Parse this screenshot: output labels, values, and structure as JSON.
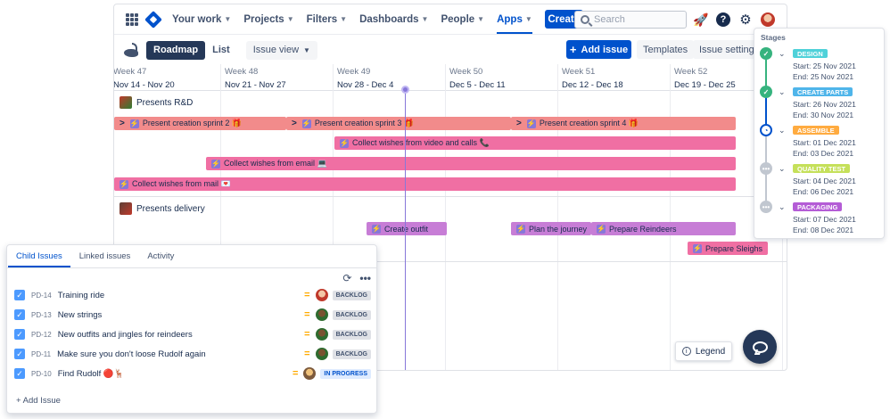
{
  "nav": {
    "items": [
      {
        "label": "Your work"
      },
      {
        "label": "Projects"
      },
      {
        "label": "Filters"
      },
      {
        "label": "Dashboards"
      },
      {
        "label": "People"
      },
      {
        "label": "Apps"
      }
    ],
    "active": "Apps",
    "create_label": "Create",
    "search_placeholder": "Search"
  },
  "toolbar": {
    "roadmap_label": "Roadmap",
    "list_label": "List",
    "view_label": "Issue view",
    "add_issue_label": "Add issue",
    "templates_label": "Templates",
    "settings_label": "Issue settings"
  },
  "weeks": [
    {
      "week": "Week 47",
      "dates": "Nov 14 - Nov 20"
    },
    {
      "week": "Week 48",
      "dates": "Nov 21 - Nov 27"
    },
    {
      "week": "Week 49",
      "dates": "Nov 28 - Dec 4"
    },
    {
      "week": "Week 50",
      "dates": "Dec 5 - Dec 11"
    },
    {
      "week": "Week 51",
      "dates": "Dec 12 - Dec 18"
    },
    {
      "week": "Week 52",
      "dates": "Dec 19 - Dec 25"
    }
  ],
  "groups": [
    {
      "label": "Presents R&D"
    },
    {
      "label": "Presents delivery"
    }
  ],
  "bars": [
    {
      "label": "Present creation sprint 2 🎁"
    },
    {
      "label": "Present creation sprint 3 🎁"
    },
    {
      "label": "Present creation sprint 4 🎁"
    },
    {
      "label": "Collect wishes from video and calls 📞"
    },
    {
      "label": "Collect wishes from email 💻"
    },
    {
      "label": "Collect wishes from mail 💌"
    },
    {
      "label": "Create outfit"
    },
    {
      "label": "Plan the journey"
    },
    {
      "label": "Prepare Reindeers"
    },
    {
      "label": "Prepare Sleighs"
    }
  ],
  "stages": {
    "title": "Stages",
    "items": [
      {
        "name": "DESIGN",
        "start": "Start: 25 Nov 2021",
        "end": "End: 25 Nov 2021",
        "state": "done",
        "color": "#4fd1d9"
      },
      {
        "name": "CREATE PARTS",
        "start": "Start: 26 Nov 2021",
        "end": "End: 30 Nov 2021",
        "state": "done",
        "color": "#4fb5ea"
      },
      {
        "name": "ASSEMBLE",
        "start": "Start: 01 Dec 2021",
        "end": "End: 03 Dec 2021",
        "state": "current",
        "color": "#ffab40"
      },
      {
        "name": "QUALITY TEST",
        "start": "Start: 04 Dec 2021",
        "end": "End: 06 Dec 2021",
        "state": "pending",
        "color": "#c5e05a"
      },
      {
        "name": "PACKAGING",
        "start": "Start: 07 Dec 2021",
        "end": "End: 08 Dec 2021",
        "state": "pending",
        "color": "#b45cd6"
      }
    ]
  },
  "child_panel": {
    "tabs": [
      {
        "label": "Child Issues"
      },
      {
        "label": "Linked issues"
      },
      {
        "label": "Activity"
      }
    ],
    "issues": [
      {
        "key": "PD-14",
        "summary": "Training ride",
        "status": "BACKLOG"
      },
      {
        "key": "PD-13",
        "summary": "New strings",
        "status": "BACKLOG"
      },
      {
        "key": "PD-12",
        "summary": "New outfits and jingles for reindeers",
        "status": "BACKLOG"
      },
      {
        "key": "PD-11",
        "summary": "Make sure you don't loose Rudolf again",
        "status": "BACKLOG"
      },
      {
        "key": "PD-10",
        "summary": "Find Rudolf 🔴🦌",
        "status": "IN PROGRESS"
      }
    ],
    "add_label": "+ Add Issue"
  },
  "legend_label": "Legend",
  "icons": [
    "app-grid-icon",
    "jira-logo-icon",
    "search-icon",
    "notification-icon",
    "help-icon",
    "settings-icon",
    "swan-icon",
    "refresh-icon",
    "more-icon",
    "info-icon",
    "chat-icon"
  ]
}
